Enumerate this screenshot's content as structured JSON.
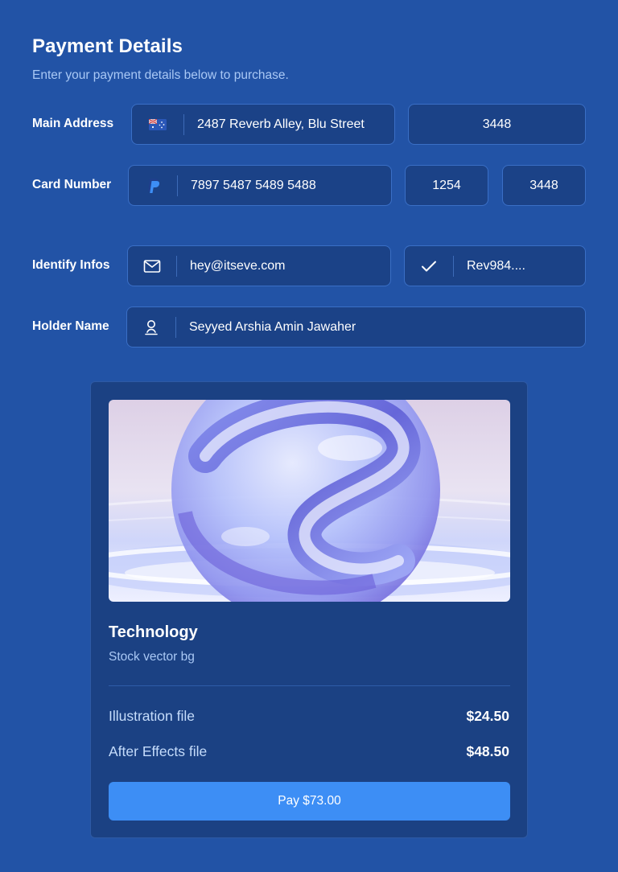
{
  "header": {
    "title": "Payment Details",
    "subtitle": "Enter your payment details below to purchase."
  },
  "main_address": {
    "label": "Main Address",
    "flag_icon": "australia-flag-icon",
    "address": "2487 Reverb Alley, Blu Street",
    "code": "3448"
  },
  "card_number": {
    "label": "Card Number",
    "brand_icon": "paypal-icon",
    "number": "7897 5487 5489 5488",
    "field_2": "1254",
    "field_3": "3448"
  },
  "identify_infos": {
    "label": "Identify Infos",
    "email_icon": "mail-icon",
    "email": "hey@itseve.com",
    "check_icon": "check-icon",
    "reference": "Rev984...."
  },
  "holder_name": {
    "label": "Holder Name",
    "user_icon": "user-icon",
    "name": "Seyyed Arshia Amin Jawaher"
  },
  "product": {
    "image_icon": "glass-sphere-image",
    "title": "Technology",
    "subtitle": "Stock vector bg",
    "items": [
      {
        "label": "Illustration file",
        "price": "$24.50"
      },
      {
        "label": "After Effects file",
        "price": "$48.50"
      }
    ],
    "pay_label": "Pay $73.00"
  },
  "colors": {
    "background": "#2253a6",
    "field_bg": "#1b4287",
    "card_bg": "#1b4183",
    "accent": "#3d8ef5",
    "muted_text": "#a9c8f5"
  }
}
